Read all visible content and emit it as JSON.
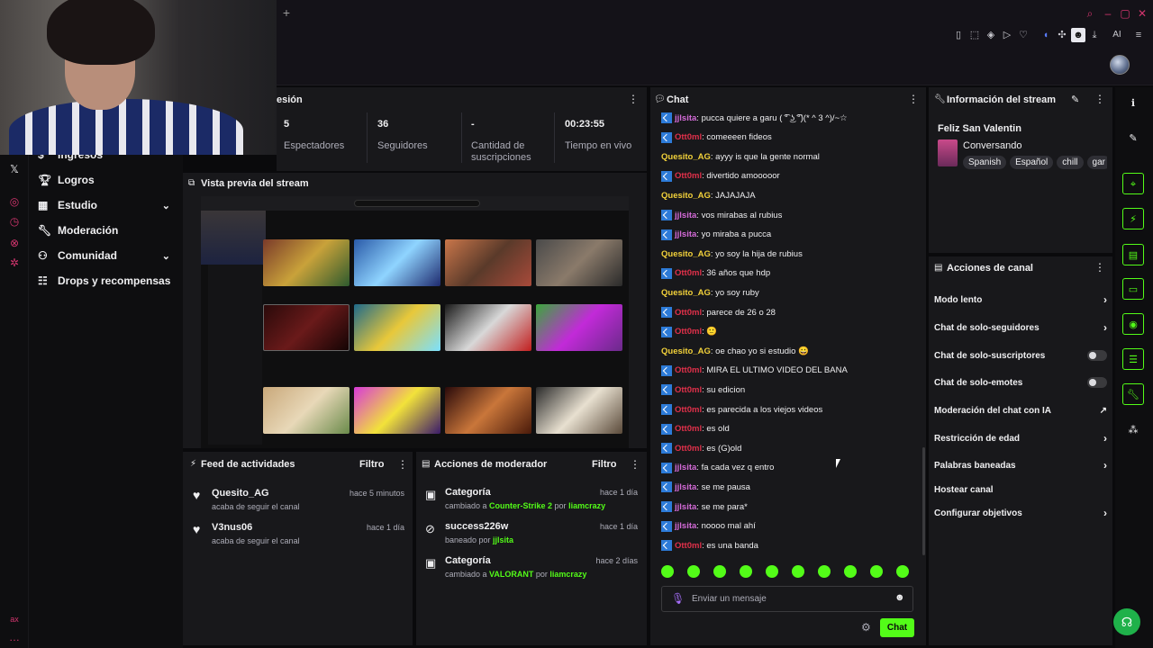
{
  "left_nav": {
    "items": [
      {
        "label": "Ingresos"
      },
      {
        "label": "Logros"
      },
      {
        "label": "Estudio"
      },
      {
        "label": "Moderación"
      },
      {
        "label": "Comunidad"
      },
      {
        "label": "Drops y recompensas"
      }
    ]
  },
  "stats": {
    "title": "esión",
    "items": [
      {
        "value": "5",
        "label": "Espectadores"
      },
      {
        "value": "36",
        "label": "Seguidores"
      },
      {
        "value": "-",
        "label": "Cantidad de suscripciones"
      },
      {
        "value": "00:23:55",
        "label": "Tiempo en vivo"
      }
    ]
  },
  "preview": {
    "title": "Vista previa del stream"
  },
  "feed": {
    "title": "Feed de actividades",
    "filter_label": "Filtro",
    "rows": [
      {
        "user": "Quesito_AG",
        "action": "acaba de seguir el canal",
        "time": "hace 5 minutos"
      },
      {
        "user": "V3nus06",
        "action": "acaba de seguir el canal",
        "time": "hace 1 día"
      }
    ]
  },
  "mod_actions": {
    "title": "Acciones de moderador",
    "filter_label": "Filtro",
    "rows": [
      {
        "title": "Categoría",
        "prefix": "cambiado a ",
        "target": "Counter-Strike 2",
        "by": " por ",
        "mod": "liamcrazy",
        "time": "hace 1 día"
      },
      {
        "title": "success226w",
        "prefix": "baneado por ",
        "target": "jjlsita",
        "by": "",
        "mod": "",
        "time": "hace 1 día"
      },
      {
        "title": "Categoría",
        "prefix": "cambiado a ",
        "target": "VALORANT",
        "by": " por ",
        "mod": "liamcrazy",
        "time": "hace 2 días"
      }
    ]
  },
  "chat": {
    "title": "Chat",
    "input_placeholder": "Enviar un mensaje",
    "send_label": "Chat",
    "messages": [
      {
        "user": "jjlsita",
        "color": "pink",
        "badge": true,
        "text": ": pucca quiere a garu ( ͡° ͜ʖ ͡°)(* ^ 3 ^)/~☆"
      },
      {
        "user": "Ott0ml",
        "color": "red",
        "badge": true,
        "text": ": comeeeen fideos"
      },
      {
        "user": "Quesito_AG",
        "color": "yellow",
        "badge": false,
        "text": ": ayyy is que la gente normal"
      },
      {
        "user": "Ott0ml",
        "color": "red",
        "badge": true,
        "text": ": divertido amooooor"
      },
      {
        "user": "Quesito_AG",
        "color": "yellow",
        "badge": false,
        "text": ": JAJAJAJA"
      },
      {
        "user": "jjlsita",
        "color": "pink",
        "badge": true,
        "text": ": vos mirabas al rubius"
      },
      {
        "user": "jjlsita",
        "color": "pink",
        "badge": true,
        "text": ": yo miraba a pucca"
      },
      {
        "user": "Quesito_AG",
        "color": "yellow",
        "badge": false,
        "text": ": yo soy la hija de rubius"
      },
      {
        "user": "Ott0ml",
        "color": "red",
        "badge": true,
        "text": ": 36 años que hdp"
      },
      {
        "user": "Quesito_AG",
        "color": "yellow",
        "badge": false,
        "text": ": yo soy ruby"
      },
      {
        "user": "Ott0ml",
        "color": "red",
        "badge": true,
        "text": ": parece de 26 o 28"
      },
      {
        "user": "Ott0ml",
        "color": "red",
        "badge": true,
        "text": ": 🙂"
      },
      {
        "user": "Quesito_AG",
        "color": "yellow",
        "badge": false,
        "text": ": oe chao yo si estudio 😀"
      },
      {
        "user": "Ott0ml",
        "color": "red",
        "badge": true,
        "text": ": MIRA EL ULTIMO VIDEO DEL BANA"
      },
      {
        "user": "Ott0ml",
        "color": "red",
        "badge": true,
        "text": ": su edicion"
      },
      {
        "user": "Ott0ml",
        "color": "red",
        "badge": true,
        "text": ": es parecida a los viejos videos"
      },
      {
        "user": "Ott0ml",
        "color": "red",
        "badge": true,
        "text": ": es old"
      },
      {
        "user": "Ott0ml",
        "color": "red",
        "badge": true,
        "text": ": es (G)old"
      },
      {
        "user": "jjlsita",
        "color": "pink",
        "badge": true,
        "text": ": fa cada vez q entro"
      },
      {
        "user": "jjlsita",
        "color": "pink",
        "badge": true,
        "text": ": se me pausa"
      },
      {
        "user": "jjlsita",
        "color": "pink",
        "badge": true,
        "text": ": se me para*"
      },
      {
        "user": "jjlsita",
        "color": "pink",
        "badge": true,
        "text": ": noooo mal ahí"
      },
      {
        "user": "Ott0ml",
        "color": "red",
        "badge": true,
        "text": ": es una banda"
      }
    ]
  },
  "stream_info": {
    "title": "Información del stream",
    "stream_title": "Feliz San Valentin",
    "category": "Conversando",
    "tags": [
      "Spanish",
      "Español",
      "chill",
      "gar"
    ]
  },
  "channel_actions": {
    "title": "Acciones de canal",
    "items": [
      {
        "label": "Modo lento",
        "kind": "chevron"
      },
      {
        "label": "Chat de solo-seguidores",
        "kind": "chevron"
      },
      {
        "label": "Chat de solo-suscriptores",
        "kind": "toggle"
      },
      {
        "label": "Chat de solo-emotes",
        "kind": "toggle"
      },
      {
        "label": "Moderación del chat con IA",
        "kind": "external"
      },
      {
        "label": "Restricción de edad",
        "kind": "chevron"
      },
      {
        "label": "Palabras baneadas",
        "kind": "chevron"
      },
      {
        "label": "Hostear canal",
        "kind": "none"
      },
      {
        "label": "Configurar objetivos",
        "kind": "chevron"
      }
    ]
  },
  "browser": {
    "ai_label": "AI"
  },
  "colors": {
    "accent": "#53fc18",
    "background": "#0a0a0c",
    "panel": "#18181b",
    "rail_accent": "#d4356e"
  }
}
